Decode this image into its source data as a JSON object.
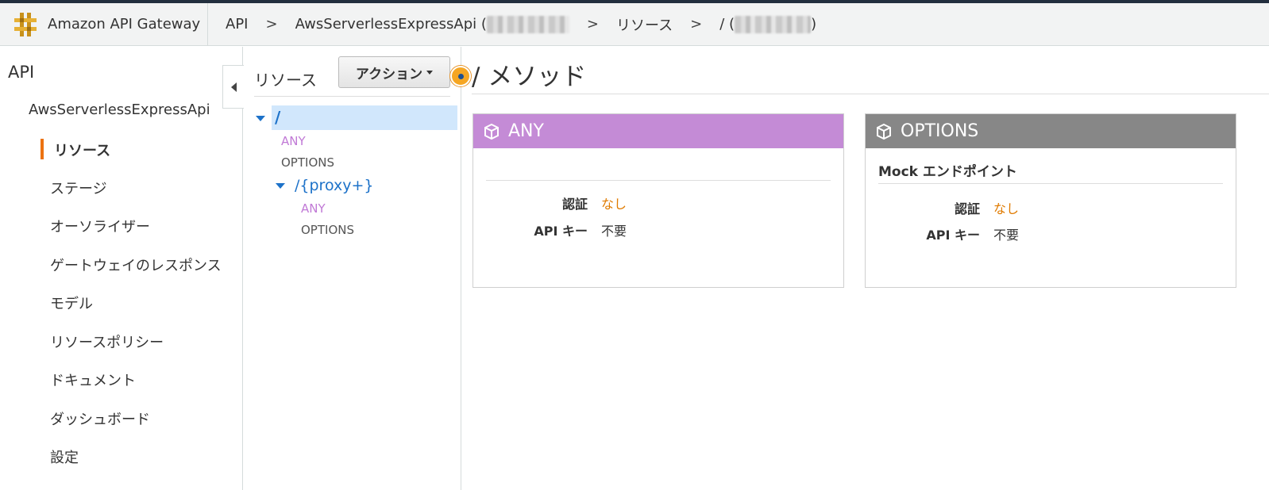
{
  "header": {
    "brand": "Amazon API Gateway",
    "breadcrumbs": {
      "api": "API",
      "api_name": "AwsServerlessExpressApi",
      "resources": "リソース",
      "root": "/",
      "separator": ">",
      "paren_open": "(",
      "paren_close": ")"
    }
  },
  "sidebar": {
    "title": "API",
    "api_name": "AwsServerlessExpressApi",
    "items": [
      {
        "label": "リソース",
        "active": true
      },
      {
        "label": "ステージ"
      },
      {
        "label": "オーソライザー"
      },
      {
        "label": "ゲートウェイのレスポンス"
      },
      {
        "label": "モデル"
      },
      {
        "label": "リソースポリシー"
      },
      {
        "label": "ドキュメント"
      },
      {
        "label": "ダッシュボード"
      },
      {
        "label": "設定"
      }
    ]
  },
  "resources": {
    "title": "リソース",
    "action_button": "アクション",
    "tree": {
      "root": "/",
      "root_methods": [
        "ANY",
        "OPTIONS"
      ],
      "proxy": "/{proxy+}",
      "proxy_methods": [
        "ANY",
        "OPTIONS"
      ]
    }
  },
  "main": {
    "title": "/ メソッド",
    "cards": [
      {
        "method": "ANY",
        "subtitle": "",
        "auth_label": "認証",
        "auth_value": "なし",
        "apikey_label": "API キー",
        "apikey_value": "不要"
      },
      {
        "method": "OPTIONS",
        "subtitle": "Mock エンドポイント",
        "auth_label": "認証",
        "auth_value": "なし",
        "apikey_label": "API キー",
        "apikey_value": "不要"
      }
    ]
  },
  "colors": {
    "any": "#c48bd6",
    "options": "#878787",
    "accent": "#ec7211",
    "link": "#1d72c9",
    "none_value": "#e07b00"
  }
}
